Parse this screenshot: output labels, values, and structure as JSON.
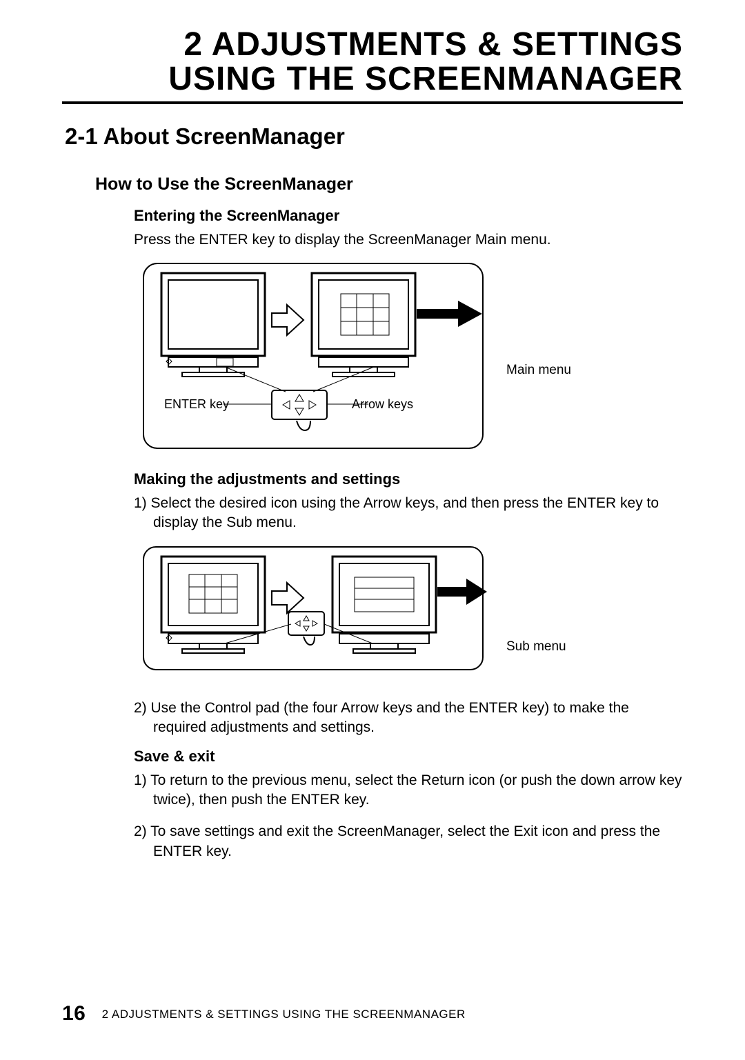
{
  "chapter": {
    "number": "2",
    "title_line1": "ADJUSTMENTS & SETTINGS",
    "title_line2": "USING THE SCREENMANAGER"
  },
  "section": {
    "number": "2-1",
    "title": "About ScreenManager"
  },
  "howto": {
    "title": "How to Use the ScreenManager",
    "entering": {
      "title": "Entering the ScreenManager",
      "text": "Press the ENTER key to display the ScreenManager Main menu.",
      "label_enter": "ENTER key",
      "label_arrow": "Arrow keys",
      "label_main": "Main menu"
    },
    "making": {
      "title": "Making the adjustments and settings",
      "step1": "1)  Select the desired icon using the Arrow keys, and then press the ENTER key to display the Sub menu.",
      "step2": "2)  Use the Control pad (the four Arrow keys and the ENTER key) to make the required adjustments and settings.",
      "label_sub": "Sub menu"
    },
    "save": {
      "title": "Save & exit",
      "step1": "1)  To return to the previous menu, select the Return icon (or push the down   arrow key twice), then push the ENTER key.",
      "step2": "2)  To save settings and exit the ScreenManager, select the Exit icon and press the ENTER key."
    }
  },
  "footer": {
    "page_number": "16",
    "text": "2   ADJUSTMENTS & SETTINGS USING THE SCREENMANAGER"
  }
}
